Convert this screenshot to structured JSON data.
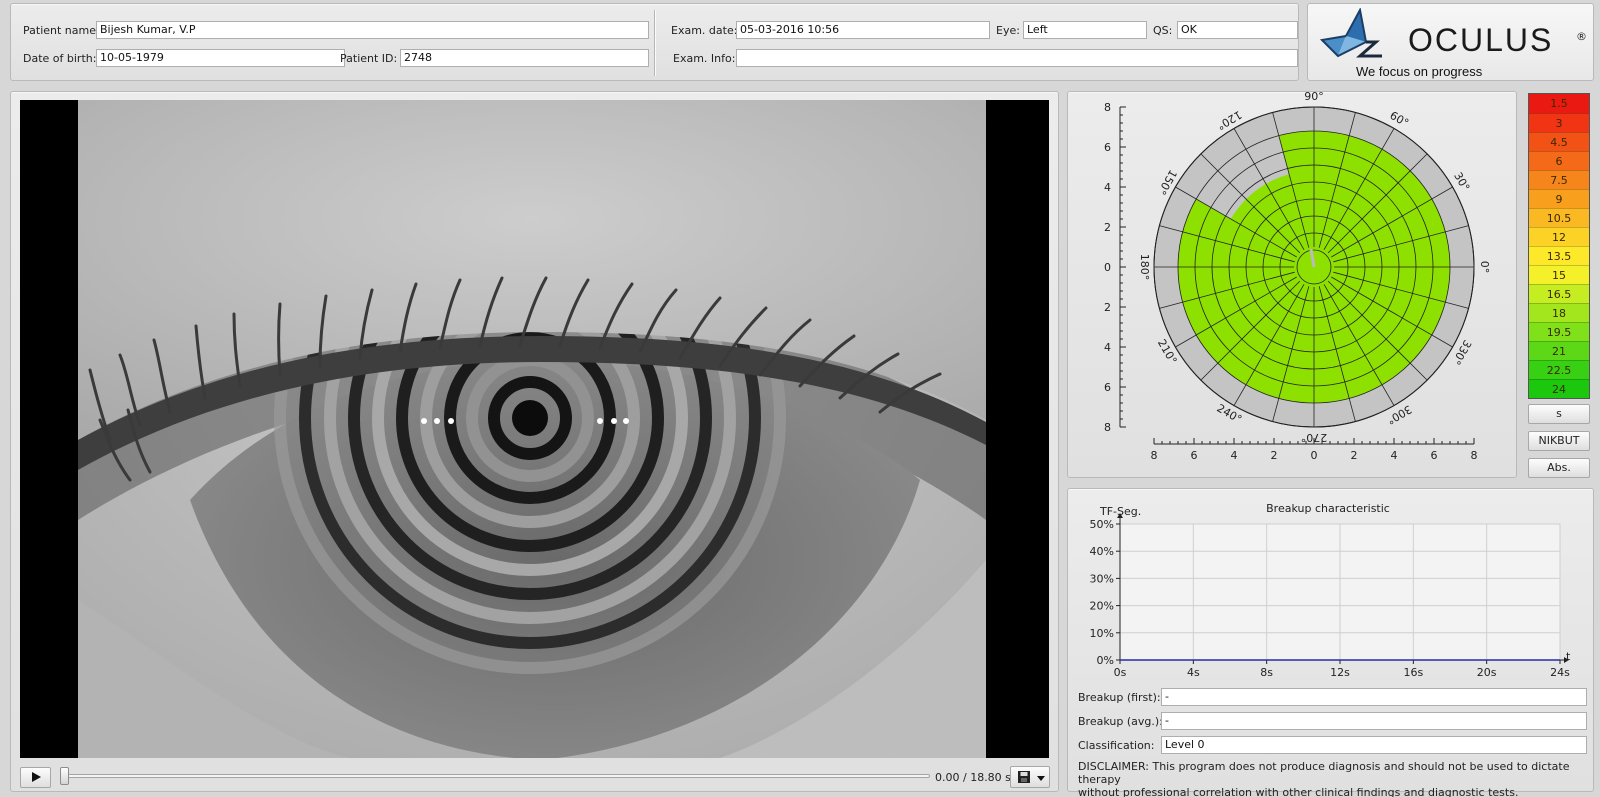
{
  "patient": {
    "name_label": "Patient name:",
    "name_value": "Bijesh Kumar, V.P",
    "dob_label": "Date of birth:",
    "dob_value": "10-05-1979",
    "id_label": "Patient ID:",
    "id_value": "2748"
  },
  "exam": {
    "date_label": "Exam. date:",
    "date_value": "05-03-2016 10:56",
    "eye_label": "Eye:",
    "eye_value": "Left",
    "qs_label": "QS:",
    "qs_value": "OK",
    "info_label": "Exam. Info:",
    "info_value": ""
  },
  "logo": {
    "brand": "OCULUS",
    "registered": "®",
    "tagline": "We focus on progress"
  },
  "player": {
    "play_icon": "play-icon",
    "position_fraction": 0.0,
    "time_text": "0.00 / 18.80 s",
    "save_icon": "floppy-disk-icon",
    "dropdown_icon": "triangle-down-icon"
  },
  "polar": {
    "angle_labels": [
      "90°",
      "60°",
      "30°",
      "0°",
      "330°",
      "300°",
      "270°",
      "240°",
      "210°",
      "180°",
      "150°",
      "120°"
    ],
    "left_axis_ticks": [
      "8",
      "6",
      "4",
      "2",
      "0",
      "2",
      "4",
      "6",
      "8"
    ],
    "bottom_axis_ticks": [
      "8",
      "6",
      "4",
      "2",
      "0",
      "2",
      "4",
      "6",
      "8"
    ],
    "fill_color": "#8ee000",
    "empty_color": "#c4c4c4"
  },
  "scale": {
    "values": [
      "1.5",
      "3",
      "4.5",
      "6",
      "7.5",
      "9",
      "10.5",
      "12",
      "13.5",
      "15",
      "16.5",
      "18",
      "19.5",
      "21",
      "22.5",
      "24"
    ],
    "colors": [
      "#ea1a12",
      "#f03414",
      "#f25216",
      "#f46a18",
      "#f6861c",
      "#f8a01e",
      "#fab822",
      "#fcd226",
      "#fde82a",
      "#f4f02a",
      "#c6ec22",
      "#a4e61e",
      "#80e01a",
      "#5cd816",
      "#38d012",
      "#1cc80e"
    ]
  },
  "side_buttons": {
    "s": "s",
    "nikbut": "NIKBUT",
    "abs": "Abs."
  },
  "chart_data": {
    "type": "line",
    "title": "Breakup characteristic",
    "ylabel": "TF-Seg.",
    "xlabel": "t",
    "x_ticks": [
      "0s",
      "4s",
      "8s",
      "12s",
      "16s",
      "20s",
      "24s"
    ],
    "y_ticks": [
      "50%",
      "40%",
      "30%",
      "20%",
      "10%",
      "0%"
    ],
    "xlim": [
      0,
      24
    ],
    "ylim": [
      0,
      50
    ],
    "series": [
      {
        "x": [
          0,
          4,
          8,
          12,
          16,
          20,
          24
        ],
        "values": [
          0,
          0,
          0,
          0,
          0,
          0,
          0
        ],
        "color": "#2a2aa8"
      }
    ],
    "grid": true
  },
  "results": {
    "first_label": "Breakup (first):",
    "first_value": "-",
    "avg_label": "Breakup (avg.):",
    "avg_value": "-",
    "class_label": "Classification:",
    "class_value": "Level 0"
  },
  "disclaimer": {
    "line1": "DISCLAIMER: This program does not produce diagnosis and should not be used to dictate therapy",
    "line2": "without professional correlation with other clinical findings and diagnostic tests."
  }
}
